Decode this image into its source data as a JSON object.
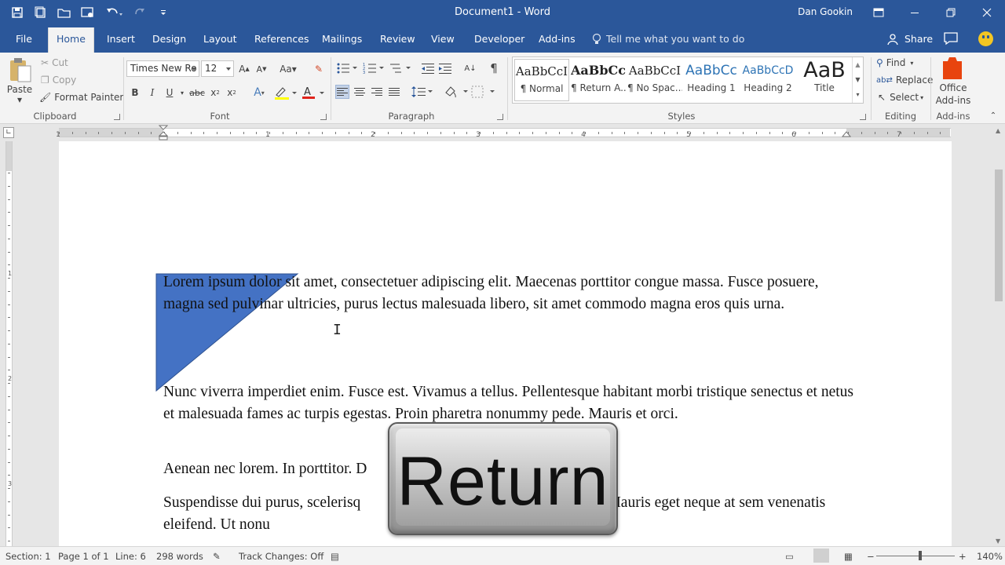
{
  "app": {
    "title": "Document1 - Word",
    "user": "Dan Gookin"
  },
  "colors": {
    "accent": "#2b579a",
    "shape_fill": "#4472c4",
    "office_addins": "#e8440f"
  },
  "tabs": [
    {
      "label": "File"
    },
    {
      "label": "Home",
      "active": true
    },
    {
      "label": "Insert"
    },
    {
      "label": "Design"
    },
    {
      "label": "Layout"
    },
    {
      "label": "References"
    },
    {
      "label": "Mailings"
    },
    {
      "label": "Review"
    },
    {
      "label": "View"
    },
    {
      "label": "Developer"
    },
    {
      "label": "Add-ins"
    }
  ],
  "tell_me": "Tell me what you want to do",
  "share_label": "Share",
  "clipboard": {
    "paste": "Paste",
    "cut": "Cut",
    "copy": "Copy",
    "format_painter": "Format Painter",
    "group": "Clipboard"
  },
  "font": {
    "name": "Times New Ro",
    "size": "12",
    "group": "Font"
  },
  "paragraph": {
    "group": "Paragraph"
  },
  "styles": {
    "group": "Styles",
    "items": [
      {
        "sample": "AaBbCcI",
        "name": "¶ Normal"
      },
      {
        "sample": "AaBbCc",
        "name": "¶ Return A..."
      },
      {
        "sample": "AaBbCcI",
        "name": "¶ No Spac..."
      },
      {
        "sample": "AaBbCc",
        "name": "Heading 1"
      },
      {
        "sample": "AaBbCcD",
        "name": "Heading 2"
      },
      {
        "sample": "AaB",
        "name": "Title"
      }
    ]
  },
  "editing": {
    "find": "Find",
    "replace": "Replace",
    "select": "Select",
    "group": "Editing"
  },
  "addins": {
    "office_line1": "Office",
    "office_line2": "Add-ins",
    "group": "Add-ins"
  },
  "ruler": {
    "numbers": [
      "1",
      "1",
      "2",
      "3",
      "4",
      "5",
      "6",
      "7"
    ],
    "vnumbers": [
      "1",
      "2",
      "3"
    ]
  },
  "document": {
    "paragraphs": [
      "Lorem ipsum dolor sit amet, consectetuer adipiscing elit. Maecenas porttitor congue massa. Fusce posuere, magna sed pulvinar ultricies, purus lectus malesuada libero, sit amet commodo magna eros quis urna.",
      "Nunc viverra imperdiet enim. Fusce est. Vivamus a tellus. Pellentesque habitant morbi tristique senectus et netus et malesuada fames ac turpis egestas. Proin pharetra nonummy pede. Mauris et orci.",
      "Aenean nec lorem. In porttitor. D",
      "Suspendisse dui purus, scelerisq                                              attis, nunc. Mauris eget neque at sem venenatis eleifend. Ut nonu"
    ]
  },
  "overlay": {
    "key_label": "Return"
  },
  "status": {
    "section": "Section: 1",
    "page": "Page 1 of 1",
    "line": "Line: 6",
    "words": "298 words",
    "track": "Track Changes: Off",
    "zoom": "140%"
  }
}
